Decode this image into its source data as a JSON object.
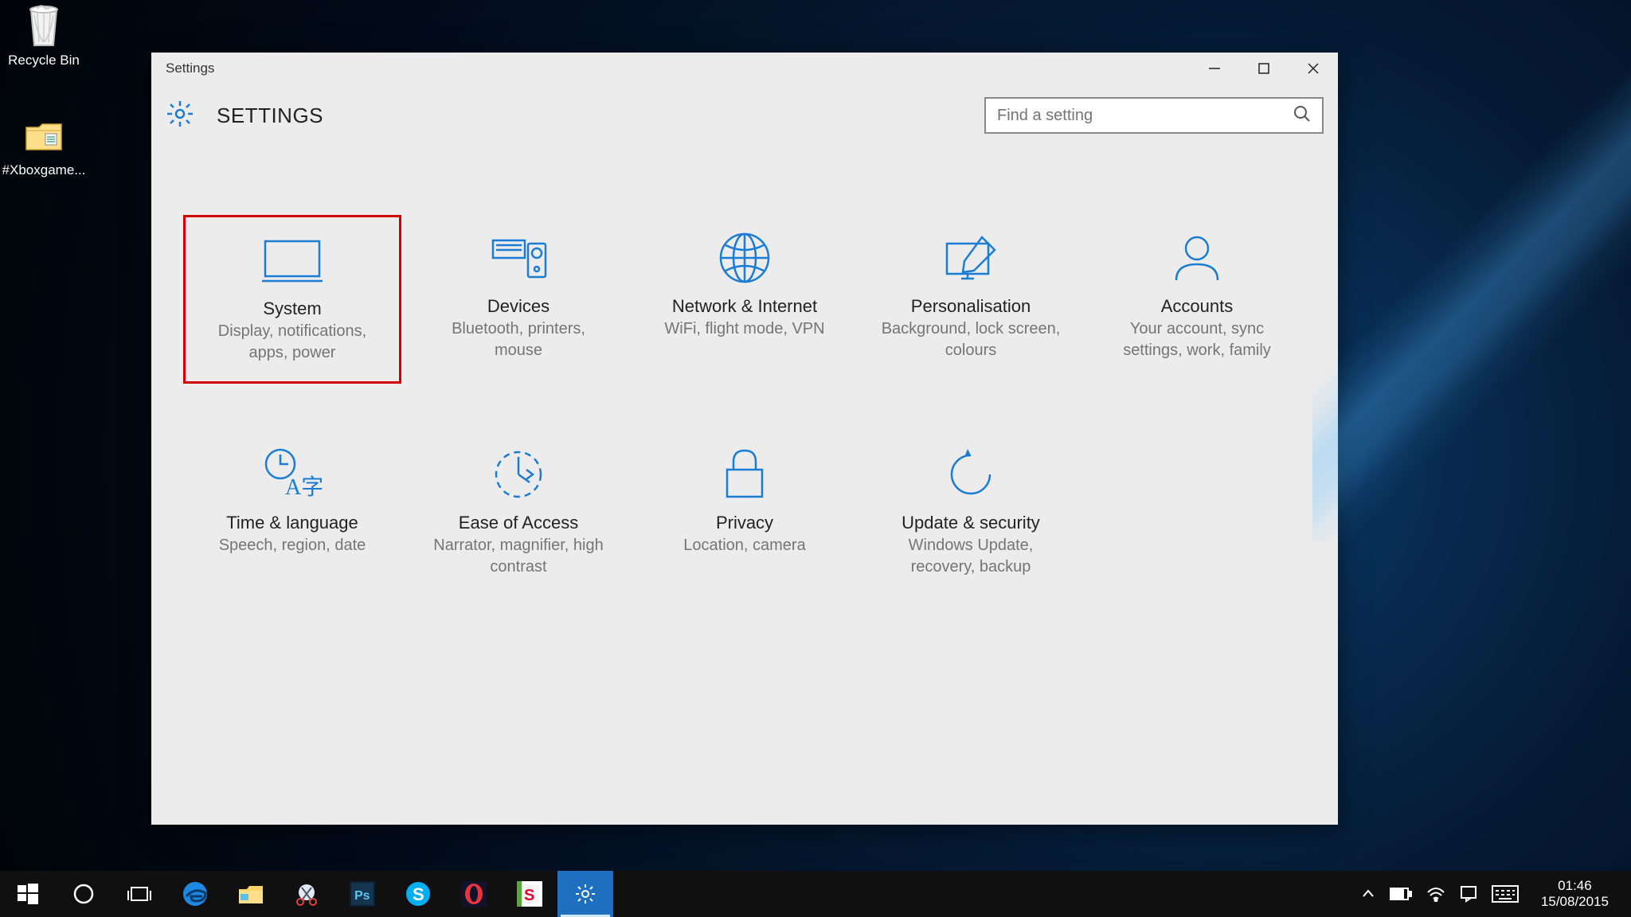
{
  "desktop_icons": [
    {
      "name": "recycle-bin",
      "label": "Recycle Bin"
    },
    {
      "name": "xbox-folder",
      "label": "#Xboxgame..."
    }
  ],
  "window": {
    "title": "Settings",
    "header": "SETTINGS",
    "search_placeholder": "Find a setting"
  },
  "tiles": [
    {
      "key": "system",
      "title": "System",
      "desc": "Display, notifications, apps, power",
      "highlighted": true
    },
    {
      "key": "devices",
      "title": "Devices",
      "desc": "Bluetooth, printers, mouse",
      "highlighted": false
    },
    {
      "key": "network",
      "title": "Network & Internet",
      "desc": "WiFi, flight mode, VPN",
      "highlighted": false
    },
    {
      "key": "personalisation",
      "title": "Personalisation",
      "desc": "Background, lock screen, colours",
      "highlighted": false
    },
    {
      "key": "accounts",
      "title": "Accounts",
      "desc": "Your account, sync settings, work, family",
      "highlighted": false
    },
    {
      "key": "time-language",
      "title": "Time & language",
      "desc": "Speech, region, date",
      "highlighted": false
    },
    {
      "key": "ease-of-access",
      "title": "Ease of Access",
      "desc": "Narrator, magnifier, high contrast",
      "highlighted": false
    },
    {
      "key": "privacy",
      "title": "Privacy",
      "desc": "Location, camera",
      "highlighted": false
    },
    {
      "key": "update-security",
      "title": "Update & security",
      "desc": "Windows Update, recovery, backup",
      "highlighted": false
    }
  ],
  "taskbar": {
    "apps": [
      {
        "key": "start",
        "name": "start-button"
      },
      {
        "key": "cortana",
        "name": "cortana-button"
      },
      {
        "key": "task-view",
        "name": "task-view-button"
      },
      {
        "key": "edge",
        "name": "edge-app"
      },
      {
        "key": "explorer",
        "name": "file-explorer-app"
      },
      {
        "key": "snip",
        "name": "snipping-tool-app"
      },
      {
        "key": "photoshop",
        "name": "photoshop-app"
      },
      {
        "key": "skype",
        "name": "skype-app"
      },
      {
        "key": "opera",
        "name": "opera-app"
      },
      {
        "key": "s-app",
        "name": "store-app"
      },
      {
        "key": "settings",
        "name": "settings-app",
        "active": true
      }
    ],
    "clock": {
      "time": "01:46",
      "date": "15/08/2015"
    }
  },
  "colors": {
    "accent": "#1b7cd4",
    "highlight_border": "#d40000"
  }
}
